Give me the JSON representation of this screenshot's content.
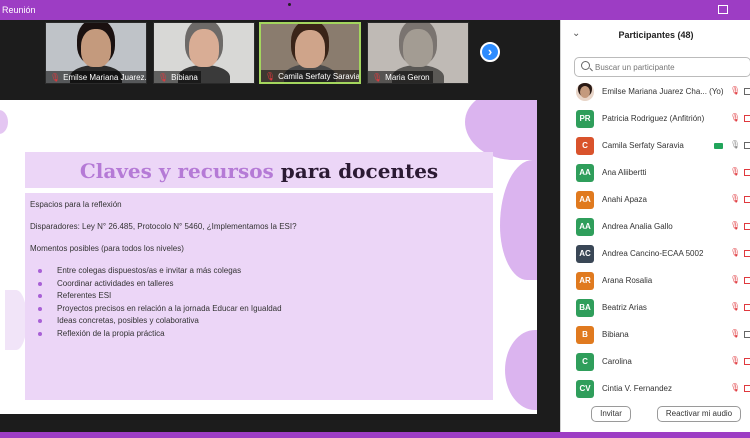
{
  "window": {
    "title": "Reunión"
  },
  "thumbnails": [
    {
      "name": "Emilse Mariana Juarez...",
      "skin": "#c49a7d",
      "hair": "#1a1110",
      "shirt": "#2b2b2b",
      "bg": "#bfc3c8",
      "active": false
    },
    {
      "name": "Bibiana",
      "skin": "#d9ad95",
      "hair": "#6d6a68",
      "shirt": "#3a3a3a",
      "bg": "#d8d8d6",
      "active": false
    },
    {
      "name": "Camila Serfaty Saravia",
      "skin": "#cfa48a",
      "hair": "#3a2418",
      "shirt": "#4a4a4a",
      "bg": "#8a7c6e",
      "active": true
    },
    {
      "name": "Maria Geron",
      "skin": "#a39c93",
      "hair": "#7a7470",
      "shirt": "#5a5855",
      "bg": "#bfbab5",
      "active": false
    }
  ],
  "slide": {
    "title_accent": "Claves y recursos",
    "title_rest": " para docentes",
    "lines": [
      "Espacios para la reflexión",
      "Disparadores: Ley N° 26.485, Protocolo N° 5460, ¿Implementamos la ESI?",
      "Momentos posibles (para todos los niveles)"
    ],
    "bullets": [
      "Entre colegas dispuestos/as e invitar a más colegas",
      "Coordinar actividades en talleres",
      "Referentes ESI",
      "Proyectos precisos en relación a la jornada Educar en Igualdad",
      "Ideas concretas, posibles y colaborativa",
      "Reflexión de la propia práctica"
    ]
  },
  "panel": {
    "heading": "Participantes (48)",
    "search_placeholder": "Buscar un participante",
    "participants": [
      {
        "initials": "",
        "name": "Emilse Mariana Juarez Cha... (Yo)",
        "color": "#c49a7d",
        "photo": true,
        "mic": "off",
        "cam": "ok",
        "video": false
      },
      {
        "initials": "PR",
        "name": "Patricia Rodriguez (Anfitrión)",
        "color": "#2f9e5b",
        "photo": false,
        "mic": "off",
        "cam": "off",
        "video": false
      },
      {
        "initials": "C",
        "name": "Camila Serfaty Saravia",
        "color": "#d9532c",
        "photo": false,
        "mic": "on",
        "cam": "ok",
        "video": true
      },
      {
        "initials": "AA",
        "name": "Ana Aliibertti",
        "color": "#2f9e5b",
        "photo": false,
        "mic": "off",
        "cam": "off",
        "video": false
      },
      {
        "initials": "AA",
        "name": "Anahi Apaza",
        "color": "#e07a1f",
        "photo": false,
        "mic": "off",
        "cam": "off",
        "video": false
      },
      {
        "initials": "AA",
        "name": "Andrea Analia Gallo",
        "color": "#2f9e5b",
        "photo": false,
        "mic": "off",
        "cam": "off",
        "video": false
      },
      {
        "initials": "AC",
        "name": "Andrea Cancino-ECAA 5002",
        "color": "#3a4756",
        "photo": false,
        "mic": "off",
        "cam": "off",
        "video": false
      },
      {
        "initials": "AR",
        "name": "Arana Rosalia",
        "color": "#e07a1f",
        "photo": false,
        "mic": "off",
        "cam": "off",
        "video": false
      },
      {
        "initials": "BA",
        "name": "Beatriz Arias",
        "color": "#2f9e5b",
        "photo": false,
        "mic": "off",
        "cam": "off",
        "video": false
      },
      {
        "initials": "B",
        "name": "Bibiana",
        "color": "#e07a1f",
        "photo": false,
        "mic": "off",
        "cam": "ok",
        "video": false
      },
      {
        "initials": "C",
        "name": "Carolina",
        "color": "#2f9e5b",
        "photo": false,
        "mic": "off",
        "cam": "off",
        "video": false
      },
      {
        "initials": "CV",
        "name": "Cintia V. Fernandez",
        "color": "#2f9e5b",
        "photo": false,
        "mic": "off",
        "cam": "off",
        "video": false
      }
    ],
    "invite_label": "Invitar",
    "unmute_label": "Reactivar mi audio"
  }
}
